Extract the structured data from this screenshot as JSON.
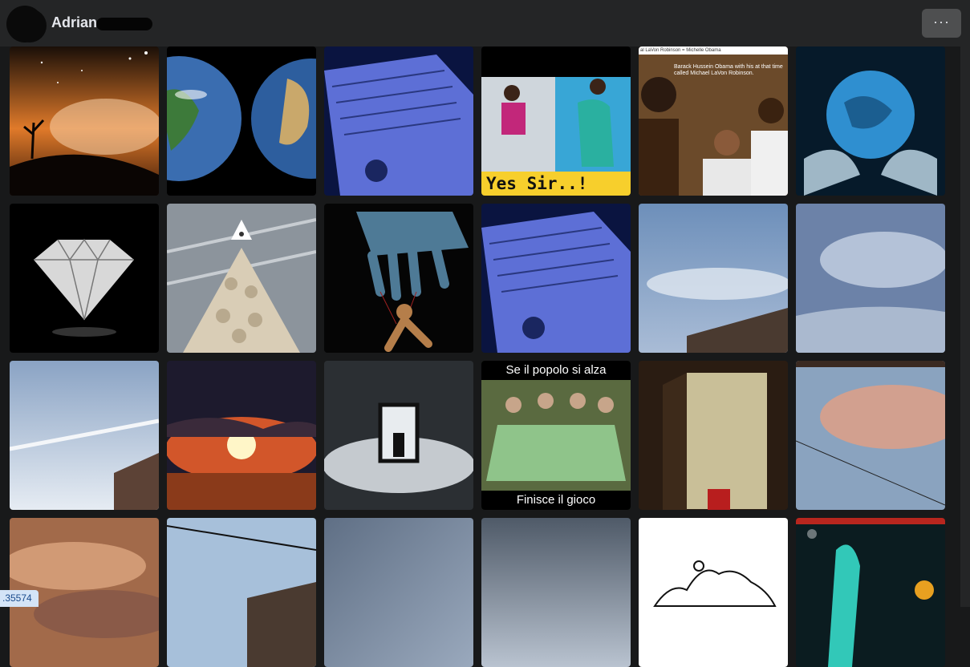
{
  "header": {
    "profile_name": "Adriana",
    "more_icon": "more-horizontal-icon",
    "more_label": "···"
  },
  "photos": [
    {
      "row": 1,
      "col": 1,
      "subject": "night-sky-tree"
    },
    {
      "row": 1,
      "col": 2,
      "subject": "earth-globes"
    },
    {
      "row": 1,
      "col": 3,
      "subject": "blue-book"
    },
    {
      "row": 1,
      "col": 4,
      "subject": "yes-sir-meme",
      "caption": "Yes Sir..!"
    },
    {
      "row": 1,
      "col": 5,
      "subject": "obama-photo-meme",
      "caption_top": "al LaVon Robinson = Michelle Obama",
      "caption_body": "Barack Hussein Obama with his at that time called Michael LaVon Robinson."
    },
    {
      "row": 1,
      "col": 6,
      "subject": "hands-globe"
    },
    {
      "row": 2,
      "col": 1,
      "subject": "diamond"
    },
    {
      "row": 2,
      "col": 2,
      "subject": "skulls-pyramid"
    },
    {
      "row": 2,
      "col": 3,
      "subject": "puppet-hand"
    },
    {
      "row": 2,
      "col": 4,
      "subject": "blue-book-2"
    },
    {
      "row": 2,
      "col": 5,
      "subject": "sky-roof"
    },
    {
      "row": 2,
      "col": 6,
      "subject": "cloud-sky"
    },
    {
      "row": 3,
      "col": 1,
      "subject": "sky-chemtrail"
    },
    {
      "row": 3,
      "col": 2,
      "subject": "sunset-clouds"
    },
    {
      "row": 3,
      "col": 3,
      "subject": "door-clouds"
    },
    {
      "row": 3,
      "col": 4,
      "subject": "game-table",
      "caption_top": "Se il popolo si alza",
      "caption_bottom": "Finisce il gioco"
    },
    {
      "row": 3,
      "col": 5,
      "subject": "skull-door"
    },
    {
      "row": 3,
      "col": 6,
      "subject": "pink-clouds-wires"
    },
    {
      "row": 4,
      "col": 1,
      "subject": "orange-clouds"
    },
    {
      "row": 4,
      "col": 2,
      "subject": "sky-wires"
    },
    {
      "row": 4,
      "col": 3,
      "subject": "grey-sky"
    },
    {
      "row": 4,
      "col": 4,
      "subject": "grey-sky-2"
    },
    {
      "row": 4,
      "col": 5,
      "subject": "drawing"
    },
    {
      "row": 4,
      "col": 6,
      "subject": "concert-stage"
    }
  ],
  "status": {
    "text": ".35574"
  },
  "colors": {
    "background": "#18191a",
    "header": "#242526",
    "button": "#4e4f50",
    "meme_yellow": "#f7cf2c"
  }
}
